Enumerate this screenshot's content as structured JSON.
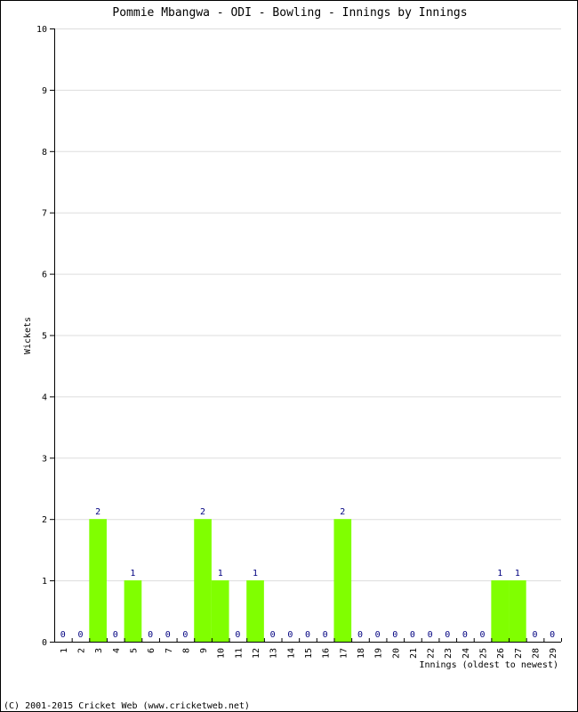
{
  "chart_data": {
    "type": "bar",
    "title": "Pommie Mbangwa - ODI - Bowling - Innings by Innings",
    "xlabel": "Innings (oldest to newest)",
    "ylabel": "Wickets",
    "ylim": [
      0,
      10
    ],
    "yticks": [
      0,
      1,
      2,
      3,
      4,
      5,
      6,
      7,
      8,
      9,
      10
    ],
    "grid": true,
    "categories": [
      "1",
      "2",
      "3",
      "4",
      "5",
      "6",
      "7",
      "8",
      "9",
      "10",
      "11",
      "12",
      "13",
      "14",
      "15",
      "16",
      "17",
      "18",
      "19",
      "20",
      "21",
      "22",
      "23",
      "24",
      "25",
      "26",
      "27",
      "28",
      "29"
    ],
    "values": [
      0,
      0,
      2,
      0,
      1,
      0,
      0,
      0,
      2,
      1,
      0,
      1,
      0,
      0,
      0,
      0,
      2,
      0,
      0,
      0,
      0,
      0,
      0,
      0,
      0,
      1,
      1,
      0,
      0
    ],
    "bar_color": "#80ff00",
    "label_color": "#000080",
    "grid_color": "#dddddd"
  },
  "footer": "(C) 2001-2015 Cricket Web (www.cricketweb.net)"
}
